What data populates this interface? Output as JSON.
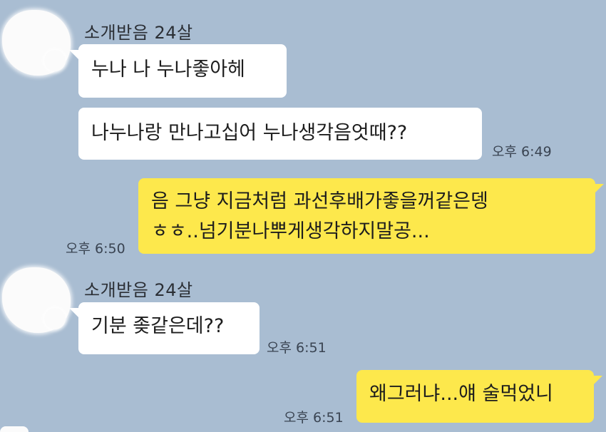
{
  "chat": {
    "sender_name": "소개받음 24살",
    "messages": [
      {
        "side": "in",
        "text": "누나 나 누나좋아헤"
      },
      {
        "side": "in",
        "text": "나누나랑 만나고십어 누나생각음엇때??",
        "time": "오후 6:49"
      },
      {
        "side": "out",
        "line1": "음 그냥 지금처럼 과선후배가좋을꺼같은뎅",
        "line2": "ㅎㅎ..넘기분나뿌게생각하지말공...",
        "time": "오후 6:50"
      },
      {
        "side": "in",
        "text": "기분 좆같은데??",
        "time": "오후 6:51"
      },
      {
        "side": "out",
        "text": "왜그러냐...얘 술먹었니",
        "time": "오후 6:51"
      }
    ]
  },
  "colors": {
    "background": "#a9bdd2",
    "incoming_bubble": "#ffffff",
    "outgoing_bubble": "#fde84c"
  },
  "icons": {
    "avatar": "blurred-profile-avatar"
  }
}
